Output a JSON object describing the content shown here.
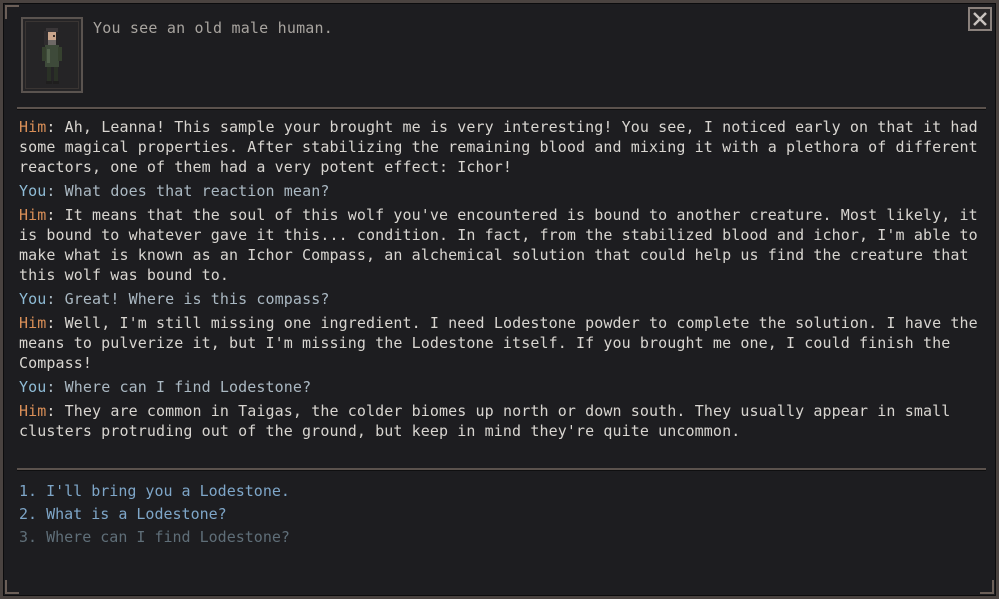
{
  "intro": "You see an old male human.",
  "dialogue": [
    {
      "speaker": "Him",
      "text": ": Ah, Leanna! This sample your brought me is very interesting! You see, I noticed early on that it had some magical properties. After stabilizing the remaining blood and mixing it with a plethora of different reactors, one of them had a very potent effect: Ichor!"
    },
    {
      "speaker": "You",
      "text": ": What does that reaction mean?"
    },
    {
      "speaker": "Him",
      "text": ": It means that the soul of this wolf you've encountered is bound to another creature. Most likely, it is bound to whatever gave it this... condition. In fact, from the stabilized blood and ichor, I'm able to make what is known as an Ichor Compass, an alchemical solution that could help us find the creature that this wolf was bound to."
    },
    {
      "speaker": "You",
      "text": ": Great! Where is this compass?"
    },
    {
      "speaker": "Him",
      "text": ": Well, I'm still missing one ingredient. I need Lodestone powder to complete the solution. I have the means to pulverize it, but I'm missing the Lodestone itself. If you brought me one, I could finish the Compass!"
    },
    {
      "speaker": "You",
      "text": ": Where can I find Lodestone?"
    },
    {
      "speaker": "Him",
      "text": ": They are common in Taigas, the colder biomes up north or down south. They usually appear in small clusters protruding out of the ground, but keep in mind they're quite uncommon."
    }
  ],
  "options": [
    "1. I'll bring you a Lodestone.",
    "2. What is a Lodestone?",
    "3. Where can I find Lodestone?"
  ],
  "icons": {
    "close": "close-icon",
    "portrait": "npc-portrait"
  },
  "colors": {
    "him": "#d88e57",
    "you": "#8fbcd6",
    "option_active": "#7ea6c8",
    "option_used": "#5f6e78"
  }
}
